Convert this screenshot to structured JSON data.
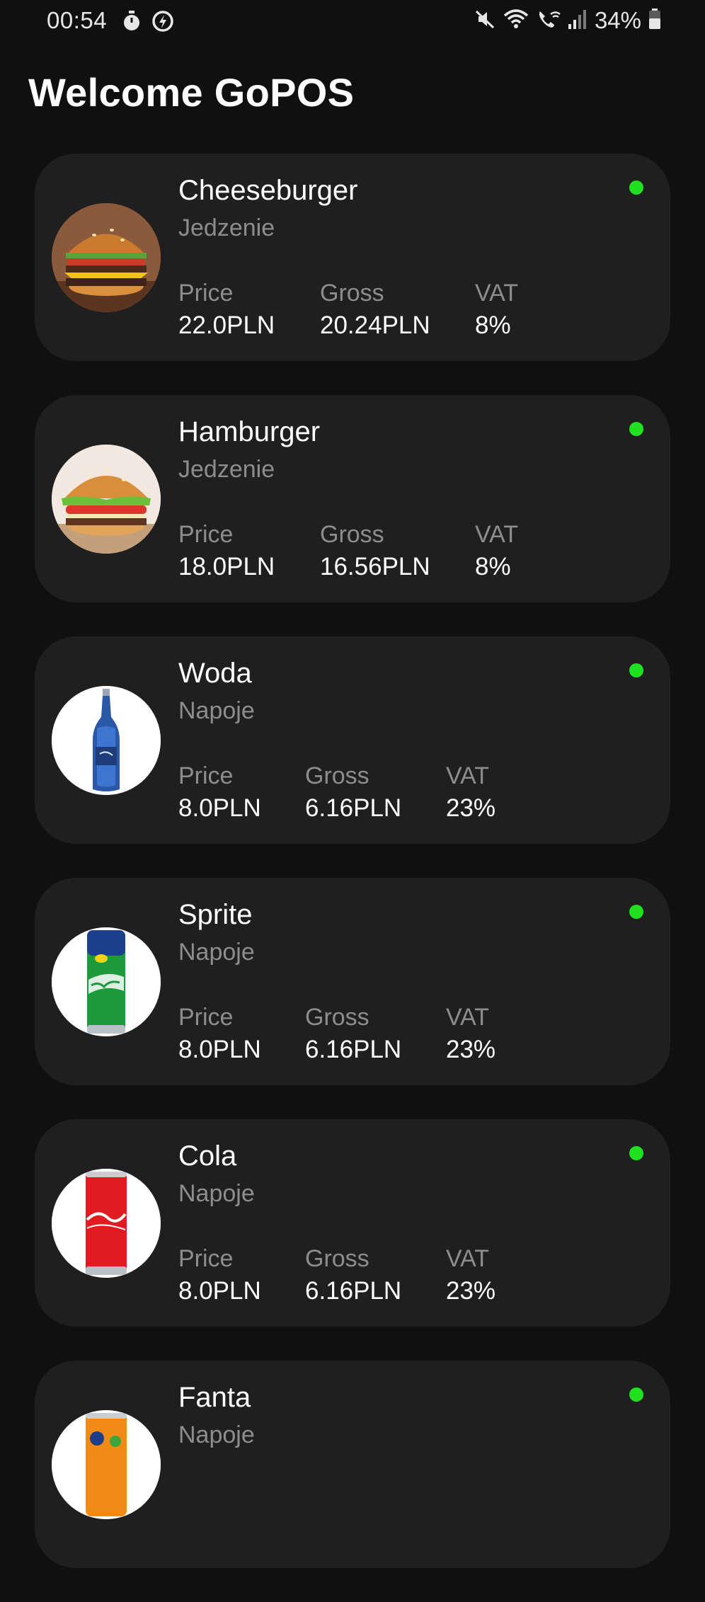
{
  "status_bar": {
    "time": "00:54",
    "battery": "34%",
    "icons": [
      "timer-icon",
      "power-saving-icon",
      "mute-icon",
      "wifi-icon",
      "wifi-calling-icon",
      "signal-icon",
      "battery-icon"
    ]
  },
  "header": {
    "title": "Welcome GoPOS"
  },
  "labels": {
    "price": "Price",
    "gross": "Gross",
    "vat": "VAT"
  },
  "products": [
    {
      "name": "Cheeseburger",
      "category": "Jedzenie",
      "price": "22.0PLN",
      "gross": "20.24PLN",
      "vat": "8%",
      "image": "cheeseburger-image",
      "active_color": "#1fe11f"
    },
    {
      "name": "Hamburger",
      "category": "Jedzenie",
      "price": "18.0PLN",
      "gross": "16.56PLN",
      "vat": "8%",
      "image": "hamburger-image",
      "active_color": "#1fe11f"
    },
    {
      "name": "Woda",
      "category": "Napoje",
      "price": "8.0PLN",
      "gross": "6.16PLN",
      "vat": "23%",
      "image": "water-bottle-image",
      "active_color": "#1fe11f"
    },
    {
      "name": "Sprite",
      "category": "Napoje",
      "price": "8.0PLN",
      "gross": "6.16PLN",
      "vat": "23%",
      "image": "sprite-can-image",
      "active_color": "#1fe11f"
    },
    {
      "name": "Cola",
      "category": "Napoje",
      "price": "8.0PLN",
      "gross": "6.16PLN",
      "vat": "23%",
      "image": "cola-can-image",
      "active_color": "#1fe11f"
    },
    {
      "name": "Fanta",
      "category": "Napoje",
      "price": "",
      "gross": "",
      "vat": "",
      "image": "fanta-can-image",
      "active_color": "#1fe11f"
    }
  ],
  "colors": {
    "background": "#101010",
    "card": "#1f1f1f",
    "muted_text": "#8d8d8d",
    "active_dot": "#1fe11f"
  }
}
